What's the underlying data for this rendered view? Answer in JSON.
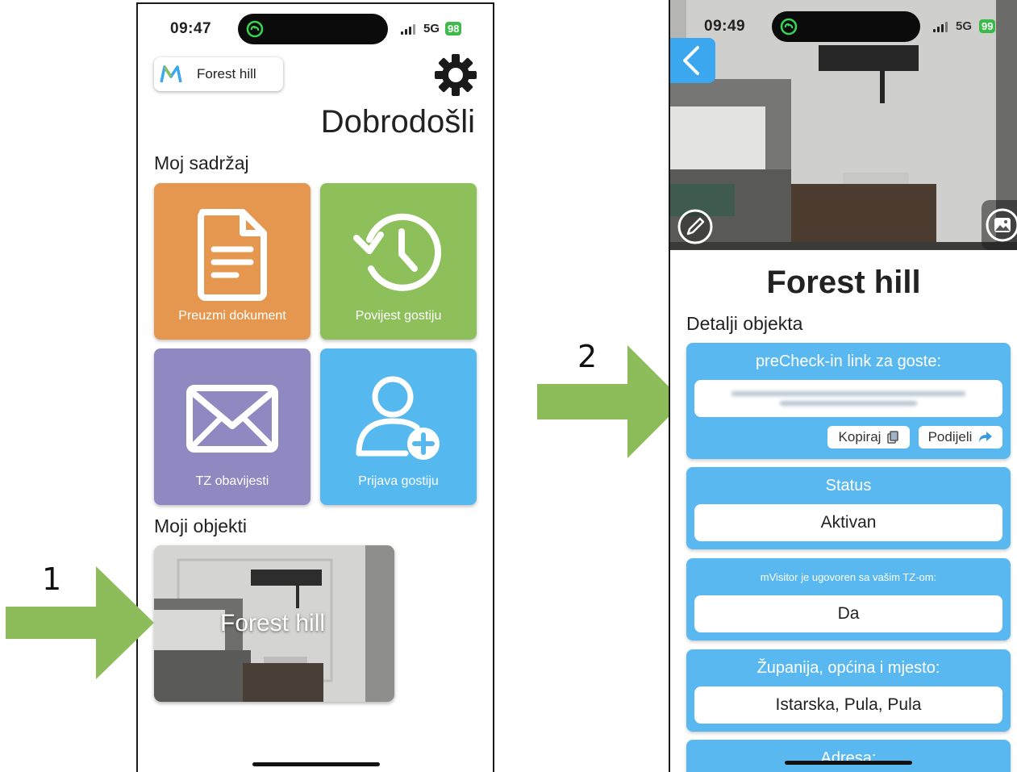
{
  "steps": {
    "step1": "1",
    "step2": "2"
  },
  "colors": {
    "arrow": "#8cbd5a",
    "orange_tile": "#e6974f",
    "green_tile": "#8dc05a",
    "purple_tile": "#9088c0",
    "blue_tile": "#55b8ef",
    "card_blue": "#59b8ef",
    "back_button": "#3aa7ee"
  },
  "screen1": {
    "status": {
      "time": "09:47",
      "network": "5G",
      "battery": "98"
    },
    "property_selector": {
      "label": "Forest hill"
    },
    "welcome": "Dobrodošli",
    "my_content_title": "Moj sadržaj",
    "tiles": [
      {
        "label": "Preuzmi dokument",
        "icon": "document-icon"
      },
      {
        "label": "Povijest gostiju",
        "icon": "history-icon"
      },
      {
        "label": "TZ obavijesti",
        "icon": "envelope-icon"
      },
      {
        "label": "Prijava gostiju",
        "icon": "add-user-icon"
      }
    ],
    "my_properties_title": "Moji objekti",
    "property_card": {
      "title": "Forest hill"
    }
  },
  "screen2": {
    "status": {
      "time": "09:49",
      "network": "5G",
      "battery": "99"
    },
    "title": "Forest hill",
    "details_title": "Detalji objekta",
    "precheck": {
      "heading": "preCheck-in link za goste:",
      "copy_label": "Kopiraj",
      "share_label": "Podijeli"
    },
    "status_card": {
      "heading": "Status",
      "value": "Aktivan"
    },
    "tz_card": {
      "heading": "mVisitor je ugovoren sa vašim TZ-om:",
      "value": "Da"
    },
    "location_card": {
      "heading": "Županija, općina i mjesto:",
      "value": "Istarska,  Pula, Pula"
    },
    "address_card": {
      "heading": "Adresa:"
    }
  }
}
